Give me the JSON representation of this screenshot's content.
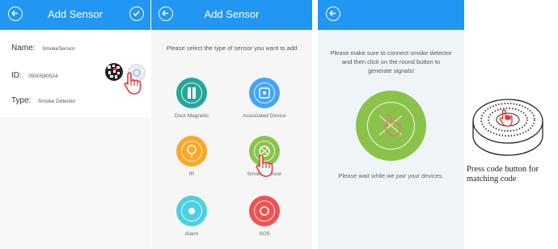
{
  "screens": [
    {
      "title": "Add Sensor",
      "form": {
        "name_label": "Name:",
        "name_value": "SmokeSensor",
        "id_label": "ID:",
        "id_value": "0900580524",
        "type_label": "Type:",
        "type_value": "Smoke Detector"
      }
    },
    {
      "title": "Add Sensor",
      "prompt": "Please select the type of sensor you want to add",
      "sensors": [
        {
          "label": "Door Magnetic",
          "color": "#26a69a",
          "icon": "door-magnetic-icon"
        },
        {
          "label": "Associated Device",
          "color": "#42a5f5",
          "icon": "associated-device-icon"
        },
        {
          "label": "IR",
          "color": "#ffa726",
          "icon": "ir-icon"
        },
        {
          "label": "Smoke Sensor",
          "color": "#8bc34a",
          "icon": "smoke-sensor-icon"
        },
        {
          "label": "Alarm",
          "color": "#4dd0e1",
          "icon": "alarm-icon"
        },
        {
          "label": "SOS",
          "color": "#ef5350",
          "icon": "sos-icon"
        }
      ]
    },
    {
      "message": "Please make sure to connect smoke detector and then click on the round button to generate signals!",
      "wait_text": "Please wait while we pair your devices."
    }
  ],
  "device_caption": "Press code button for matching code",
  "colors": {
    "header": "#2196f3",
    "pair_button": "#8bc34a",
    "hand": "#e53935"
  }
}
